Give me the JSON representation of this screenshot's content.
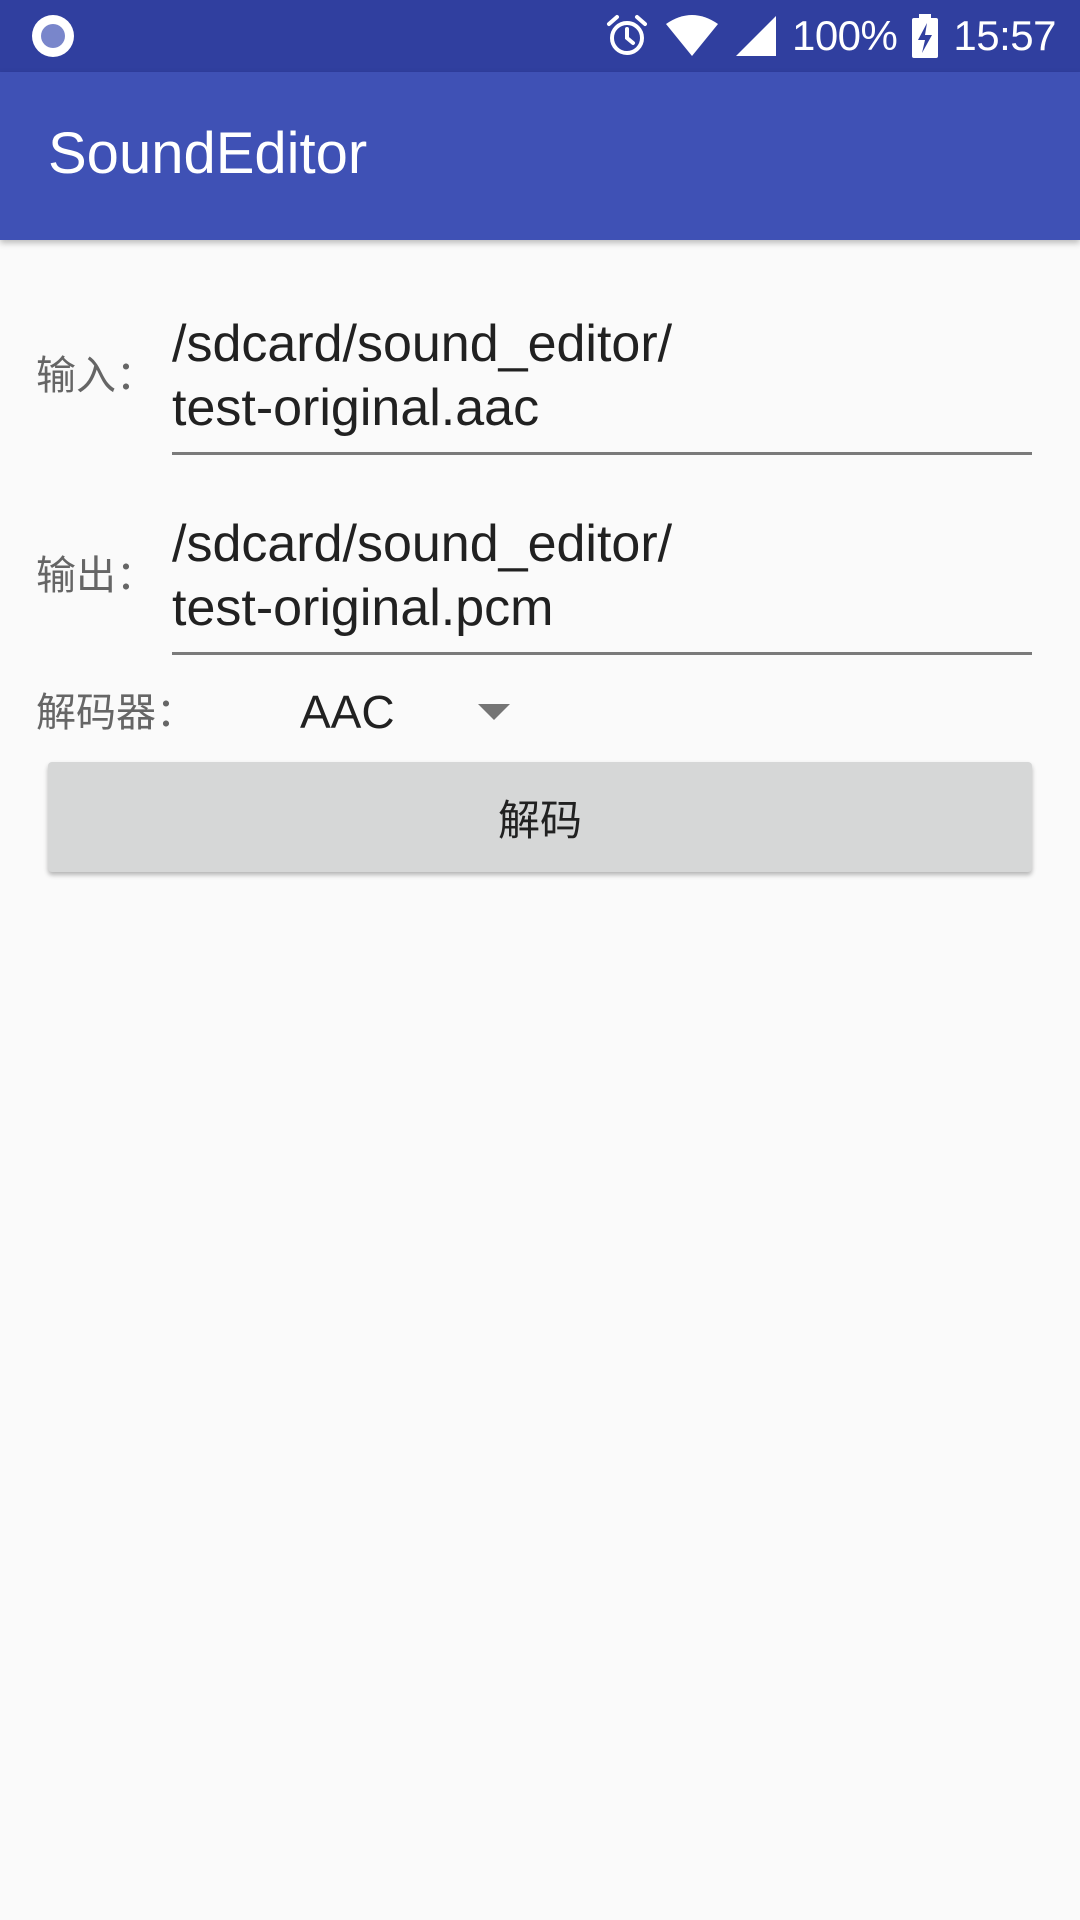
{
  "status_bar": {
    "battery_percent": "100%",
    "time": "15:57",
    "icons": [
      "circle-indicator-icon",
      "alarm-icon",
      "wifi-icon",
      "cell-signal-icon",
      "battery-charging-icon"
    ],
    "color": "#303f9f"
  },
  "app_bar": {
    "title": "SoundEditor",
    "color": "#3f51b5"
  },
  "form": {
    "input_label": "输入：",
    "input_value": "/sdcard/sound_editor/\ntest-original.aac",
    "output_label": "输出：",
    "output_value": "/sdcard/sound_editor/\ntest-original.pcm",
    "decoder_label": "解码器：",
    "decoder_selected": "AAC",
    "decode_button": "解码"
  }
}
